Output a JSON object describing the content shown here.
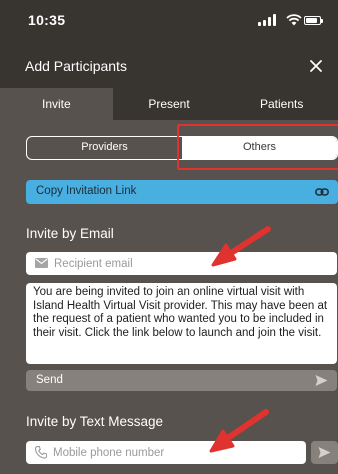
{
  "status_bar": {
    "time": "10:35"
  },
  "header": {
    "title": "Add Participants"
  },
  "tabs": [
    {
      "label": "Invite",
      "active": true
    },
    {
      "label": "Present",
      "active": false
    },
    {
      "label": "Patients",
      "active": false
    }
  ],
  "segment": {
    "options": [
      {
        "label": "Providers",
        "selected": false
      },
      {
        "label": "Others",
        "selected": true
      }
    ]
  },
  "copy_link": {
    "label": "Copy Invitation Link"
  },
  "email_section": {
    "title": "Invite by Email",
    "placeholder": "Recipient email",
    "message": "You are being invited to join an online virtual visit with Island Health Virtual Visit provider. This may have been at the request of a patient who wanted you to be included in their visit. Click the link below to launch and join the visit.",
    "send_label": "Send"
  },
  "text_section": {
    "title": "Invite by Text Message",
    "placeholder": "Mobile phone number"
  },
  "icons": {
    "close": "close-icon",
    "link": "link-icon",
    "mail": "mail-icon",
    "send": "send-icon",
    "phone": "phone-icon"
  },
  "colors": {
    "background": "#57524d",
    "header": "#38342f",
    "accent": "#49aee0",
    "annotation": "#e0322f"
  }
}
